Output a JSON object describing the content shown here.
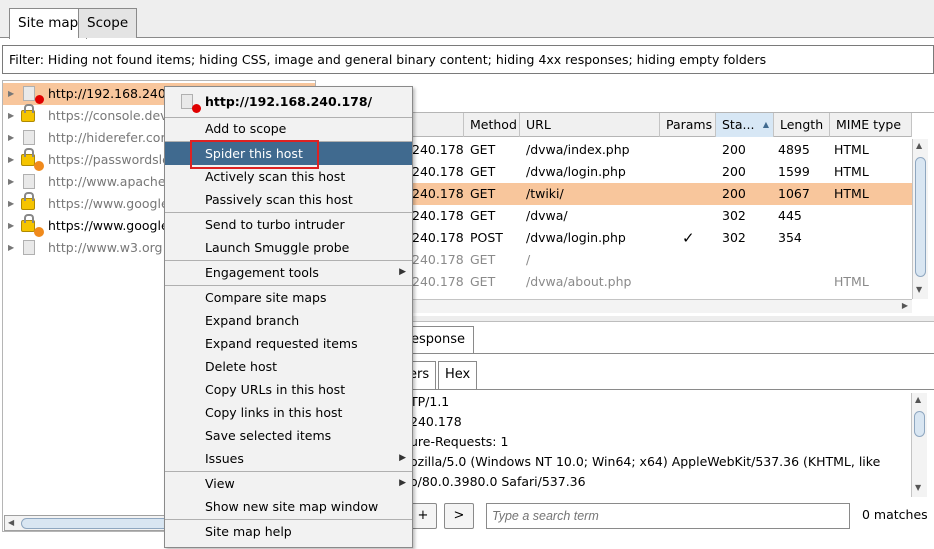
{
  "tabs": [
    "Site map",
    "Scope"
  ],
  "filter_text": "Filter: Hiding not found items;  hiding CSS, image and general binary content;  hiding 4xx responses;  hiding empty folders",
  "tree": [
    {
      "label": "http://192.168.240.178",
      "icon": "file",
      "badge": "red",
      "selected": true,
      "dim": false
    },
    {
      "label": "https://console.deve",
      "icon": "lock",
      "badge": "",
      "selected": false,
      "dim": true
    },
    {
      "label": "http://hiderefer.com",
      "icon": "file",
      "badge": "",
      "selected": false,
      "dim": true
    },
    {
      "label": "https://passwordslea",
      "icon": "lock",
      "badge": "orange",
      "selected": false,
      "dim": true
    },
    {
      "label": "http://www.apachefri",
      "icon": "file",
      "badge": "",
      "selected": false,
      "dim": true
    },
    {
      "label": "https://www.google.c",
      "icon": "lock",
      "badge": "",
      "selected": false,
      "dim": true
    },
    {
      "label": "https://www.googlea",
      "icon": "lock",
      "badge": "orange",
      "selected": false,
      "dim": false
    },
    {
      "label": "http://www.w3.org",
      "icon": "file",
      "badge": "",
      "selected": false,
      "dim": true
    }
  ],
  "table": {
    "headers": [
      "Method",
      "URL",
      "Params",
      "Sta...",
      "Length",
      "MIME type"
    ],
    "rows": [
      {
        "host": "240.178",
        "method": "GET",
        "url": "/dvwa/index.php",
        "params": "",
        "status": "200",
        "length": "4895",
        "mime": "HTML",
        "selected": false,
        "dim": false
      },
      {
        "host": "240.178",
        "method": "GET",
        "url": "/dvwa/login.php",
        "params": "",
        "status": "200",
        "length": "1599",
        "mime": "HTML",
        "selected": false,
        "dim": false
      },
      {
        "host": "240.178",
        "method": "GET",
        "url": "/twiki/",
        "params": "",
        "status": "200",
        "length": "1067",
        "mime": "HTML",
        "selected": true,
        "dim": false
      },
      {
        "host": "240.178",
        "method": "GET",
        "url": "/dvwa/",
        "params": "",
        "status": "302",
        "length": "445",
        "mime": "",
        "selected": false,
        "dim": false
      },
      {
        "host": "240.178",
        "method": "POST",
        "url": "/dvwa/login.php",
        "params": "✓",
        "status": "302",
        "length": "354",
        "mime": "",
        "selected": false,
        "dim": false
      },
      {
        "host": "240.178",
        "method": "GET",
        "url": "/",
        "params": "",
        "status": "",
        "length": "",
        "mime": "",
        "selected": false,
        "dim": true
      },
      {
        "host": "240.178",
        "method": "GET",
        "url": "/dvwa/about.php",
        "params": "",
        "status": "",
        "length": "",
        "mime": "HTML",
        "selected": false,
        "dim": true
      }
    ]
  },
  "response_tab": "esponse",
  "subtabs": [
    "ers",
    "Hex"
  ],
  "request_lines": [
    "TP/1.1",
    "240.178",
    "ure-Requests: 1",
    "ozilla/5.0 (Windows NT 10.0; Win64; x64) AppleWebKit/537.36 (KHTML, like",
    "o/80.0.3980.0 Safari/537.36"
  ],
  "nav": {
    "prev": "+",
    "next": ">"
  },
  "search": {
    "placeholder": "Type a search term",
    "matches": "0 matches"
  },
  "context_menu": {
    "header": "http://192.168.240.178/",
    "items": [
      {
        "label": "Add to scope"
      },
      {
        "label": "Spider this host",
        "highlighted": true
      },
      {
        "label": "Actively scan this host"
      },
      {
        "label": "Passively scan this host"
      },
      {
        "label": "Send to turbo intruder"
      },
      {
        "label": "Launch Smuggle probe"
      },
      {
        "label": "Engagement tools",
        "submenu": true
      },
      {
        "label": "Compare site maps"
      },
      {
        "label": "Expand branch"
      },
      {
        "label": "Expand requested items"
      },
      {
        "label": "Delete host"
      },
      {
        "label": "Copy URLs in this host"
      },
      {
        "label": "Copy links in this host"
      },
      {
        "label": "Save selected items"
      },
      {
        "label": "Issues",
        "submenu": true
      },
      {
        "label": "View",
        "submenu": true
      },
      {
        "label": "Show new site map window"
      },
      {
        "label": "Site map help"
      }
    ]
  },
  "colors": {
    "selection": "#f8c69c",
    "menu_highlight": "#406a8f",
    "red_box": "#d22222"
  }
}
